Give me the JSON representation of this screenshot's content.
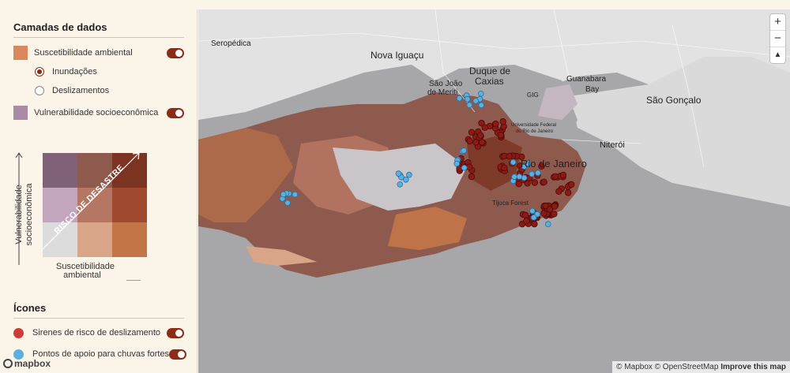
{
  "layers": {
    "title": "Camadas de dados",
    "susceptibility": {
      "label": "Suscetibilidade ambiental",
      "color": "#d9885b",
      "enabled": true
    },
    "radios": [
      {
        "label": "Inundações",
        "selected": true
      },
      {
        "label": "Deslizamentos",
        "selected": false
      }
    ],
    "vulnerability": {
      "label": "Vulnerabilidade socioeconômica",
      "color": "#a88ba4",
      "enabled": true
    }
  },
  "legend": {
    "y_label_line1": "Vulnerabilidade",
    "y_label_line2": "socioeconômica",
    "x_label_line1": "Suscetibilidade",
    "x_label_line2": "ambiental",
    "diagonal": "RISCO DE DESASTRE",
    "grid_colors": [
      [
        "#7f6277",
        "#8e5a4e",
        "#7b3322"
      ],
      [
        "#c3a5bd",
        "#b57663",
        "#9f4a2e"
      ],
      [
        "#dcdcdc",
        "#d9a589",
        "#c47548"
      ]
    ]
  },
  "icons": {
    "title": "Ícones",
    "items": [
      {
        "label": "Sirenes de risco de deslizamento",
        "color": "#cc3b35",
        "enabled": true
      },
      {
        "label": "Pontos de apoio para chuvas fortes",
        "color": "#5bb0e2",
        "enabled": true
      }
    ]
  },
  "map": {
    "places": [
      "Seropédica",
      "Nova Iguaçu",
      "Duque de",
      "Caxias",
      "São João",
      "de Meriti",
      "Guanabara",
      "Bay",
      "São Gonçalo",
      "Niterói",
      "Rio de Janeiro",
      "GIG",
      "Tijuca Forest",
      "Universidade Federal",
      "do Rio de Janeiro"
    ],
    "zoom_in": "+",
    "zoom_out": "−",
    "compass": "▲",
    "attribution_prefix": "© Mapbox © OpenStreetMap",
    "attribution_link": "Improve this map",
    "logo": "mapbox"
  }
}
